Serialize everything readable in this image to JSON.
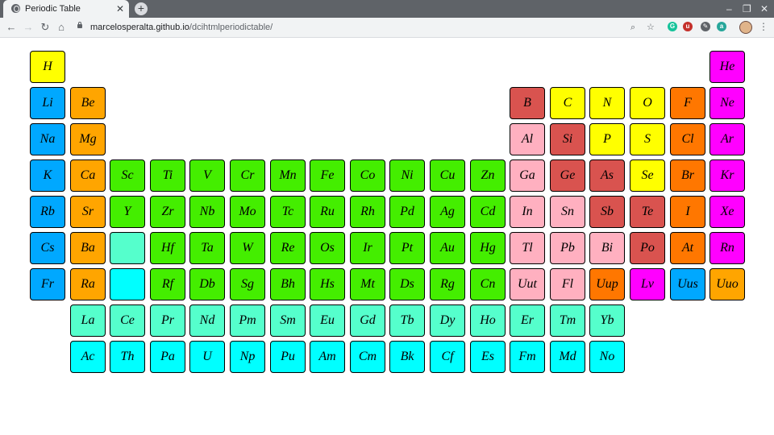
{
  "browser": {
    "tab_title": "Periodic Table",
    "tab_close": "✕",
    "new_tab": "+",
    "url_host": "marcelosperalta.github.io",
    "url_path": "/dcihtmlperiodictable/",
    "controls": {
      "minimize": "–",
      "restore": "❐",
      "close": "✕"
    },
    "nav": {
      "back": "←",
      "forward": "→",
      "reload": "↻",
      "home": "⌂"
    },
    "omni_icons": {
      "zoom": "⌕",
      "bookmark": "☆"
    },
    "extensions": [
      {
        "name": "grammarly",
        "label": "G",
        "color": "#15c39a"
      },
      {
        "name": "ublock",
        "label": "u",
        "color": "#c4302b"
      },
      {
        "name": "eyedropper",
        "label": "✎",
        "color": "#5f6368"
      },
      {
        "name": "ext-a",
        "label": "a",
        "color": "#26a69a"
      }
    ],
    "menu": "⋮"
  },
  "palette": {
    "nonmetal": "#ffff00",
    "noble": "#ff00ff",
    "alkali": "#00a8ff",
    "alkaline": "#ffa500",
    "metalloid": "#d9534f",
    "halogen": "#ff7700",
    "transition": "#44ee00",
    "post": "#ffb0c0",
    "lanth": "#55ffcc",
    "actin": "#00ffff"
  },
  "elements": [
    {
      "s": "H",
      "r": 1,
      "c": 1,
      "t": "nonmetal"
    },
    {
      "s": "He",
      "r": 1,
      "c": 18,
      "t": "noble"
    },
    {
      "s": "Li",
      "r": 2,
      "c": 1,
      "t": "alkali"
    },
    {
      "s": "Be",
      "r": 2,
      "c": 2,
      "t": "alkaline"
    },
    {
      "s": "B",
      "r": 2,
      "c": 13,
      "t": "metalloid"
    },
    {
      "s": "C",
      "r": 2,
      "c": 14,
      "t": "nonmetal"
    },
    {
      "s": "N",
      "r": 2,
      "c": 15,
      "t": "nonmetal"
    },
    {
      "s": "O",
      "r": 2,
      "c": 16,
      "t": "nonmetal"
    },
    {
      "s": "F",
      "r": 2,
      "c": 17,
      "t": "halogen"
    },
    {
      "s": "Ne",
      "r": 2,
      "c": 18,
      "t": "noble"
    },
    {
      "s": "Na",
      "r": 3,
      "c": 1,
      "t": "alkali"
    },
    {
      "s": "Mg",
      "r": 3,
      "c": 2,
      "t": "alkaline"
    },
    {
      "s": "Al",
      "r": 3,
      "c": 13,
      "t": "post"
    },
    {
      "s": "Si",
      "r": 3,
      "c": 14,
      "t": "metalloid"
    },
    {
      "s": "P",
      "r": 3,
      "c": 15,
      "t": "nonmetal"
    },
    {
      "s": "S",
      "r": 3,
      "c": 16,
      "t": "nonmetal"
    },
    {
      "s": "Cl",
      "r": 3,
      "c": 17,
      "t": "halogen"
    },
    {
      "s": "Ar",
      "r": 3,
      "c": 18,
      "t": "noble"
    },
    {
      "s": "K",
      "r": 4,
      "c": 1,
      "t": "alkali"
    },
    {
      "s": "Ca",
      "r": 4,
      "c": 2,
      "t": "alkaline"
    },
    {
      "s": "Sc",
      "r": 4,
      "c": 3,
      "t": "transition"
    },
    {
      "s": "Ti",
      "r": 4,
      "c": 4,
      "t": "transition"
    },
    {
      "s": "V",
      "r": 4,
      "c": 5,
      "t": "transition"
    },
    {
      "s": "Cr",
      "r": 4,
      "c": 6,
      "t": "transition"
    },
    {
      "s": "Mn",
      "r": 4,
      "c": 7,
      "t": "transition"
    },
    {
      "s": "Fe",
      "r": 4,
      "c": 8,
      "t": "transition"
    },
    {
      "s": "Co",
      "r": 4,
      "c": 9,
      "t": "transition"
    },
    {
      "s": "Ni",
      "r": 4,
      "c": 10,
      "t": "transition"
    },
    {
      "s": "Cu",
      "r": 4,
      "c": 11,
      "t": "transition"
    },
    {
      "s": "Zn",
      "r": 4,
      "c": 12,
      "t": "transition"
    },
    {
      "s": "Ga",
      "r": 4,
      "c": 13,
      "t": "post"
    },
    {
      "s": "Ge",
      "r": 4,
      "c": 14,
      "t": "metalloid"
    },
    {
      "s": "As",
      "r": 4,
      "c": 15,
      "t": "metalloid"
    },
    {
      "s": "Se",
      "r": 4,
      "c": 16,
      "t": "nonmetal"
    },
    {
      "s": "Br",
      "r": 4,
      "c": 17,
      "t": "halogen"
    },
    {
      "s": "Kr",
      "r": 4,
      "c": 18,
      "t": "noble"
    },
    {
      "s": "Rb",
      "r": 5,
      "c": 1,
      "t": "alkali"
    },
    {
      "s": "Sr",
      "r": 5,
      "c": 2,
      "t": "alkaline"
    },
    {
      "s": "Y",
      "r": 5,
      "c": 3,
      "t": "transition"
    },
    {
      "s": "Zr",
      "r": 5,
      "c": 4,
      "t": "transition"
    },
    {
      "s": "Nb",
      "r": 5,
      "c": 5,
      "t": "transition"
    },
    {
      "s": "Mo",
      "r": 5,
      "c": 6,
      "t": "transition"
    },
    {
      "s": "Tc",
      "r": 5,
      "c": 7,
      "t": "transition"
    },
    {
      "s": "Ru",
      "r": 5,
      "c": 8,
      "t": "transition"
    },
    {
      "s": "Rh",
      "r": 5,
      "c": 9,
      "t": "transition"
    },
    {
      "s": "Pd",
      "r": 5,
      "c": 10,
      "t": "transition"
    },
    {
      "s": "Ag",
      "r": 5,
      "c": 11,
      "t": "transition"
    },
    {
      "s": "Cd",
      "r": 5,
      "c": 12,
      "t": "transition"
    },
    {
      "s": "In",
      "r": 5,
      "c": 13,
      "t": "post"
    },
    {
      "s": "Sn",
      "r": 5,
      "c": 14,
      "t": "post"
    },
    {
      "s": "Sb",
      "r": 5,
      "c": 15,
      "t": "metalloid"
    },
    {
      "s": "Te",
      "r": 5,
      "c": 16,
      "t": "metalloid"
    },
    {
      "s": "I",
      "r": 5,
      "c": 17,
      "t": "halogen"
    },
    {
      "s": "Xe",
      "r": 5,
      "c": 18,
      "t": "noble"
    },
    {
      "s": "Cs",
      "r": 6,
      "c": 1,
      "t": "alkali"
    },
    {
      "s": "Ba",
      "r": 6,
      "c": 2,
      "t": "alkaline"
    },
    {
      "s": "",
      "r": 6,
      "c": 3,
      "t": "lanth"
    },
    {
      "s": "Hf",
      "r": 6,
      "c": 4,
      "t": "transition"
    },
    {
      "s": "Ta",
      "r": 6,
      "c": 5,
      "t": "transition"
    },
    {
      "s": "W",
      "r": 6,
      "c": 6,
      "t": "transition"
    },
    {
      "s": "Re",
      "r": 6,
      "c": 7,
      "t": "transition"
    },
    {
      "s": "Os",
      "r": 6,
      "c": 8,
      "t": "transition"
    },
    {
      "s": "Ir",
      "r": 6,
      "c": 9,
      "t": "transition"
    },
    {
      "s": "Pt",
      "r": 6,
      "c": 10,
      "t": "transition"
    },
    {
      "s": "Au",
      "r": 6,
      "c": 11,
      "t": "transition"
    },
    {
      "s": "Hg",
      "r": 6,
      "c": 12,
      "t": "transition"
    },
    {
      "s": "Tl",
      "r": 6,
      "c": 13,
      "t": "post"
    },
    {
      "s": "Pb",
      "r": 6,
      "c": 14,
      "t": "post"
    },
    {
      "s": "Bi",
      "r": 6,
      "c": 15,
      "t": "post"
    },
    {
      "s": "Po",
      "r": 6,
      "c": 16,
      "t": "metalloid"
    },
    {
      "s": "At",
      "r": 6,
      "c": 17,
      "t": "halogen"
    },
    {
      "s": "Rn",
      "r": 6,
      "c": 18,
      "t": "noble"
    },
    {
      "s": "Fr",
      "r": 7,
      "c": 1,
      "t": "alkali"
    },
    {
      "s": "Ra",
      "r": 7,
      "c": 2,
      "t": "alkaline"
    },
    {
      "s": "",
      "r": 7,
      "c": 3,
      "t": "actin"
    },
    {
      "s": "Rf",
      "r": 7,
      "c": 4,
      "t": "transition"
    },
    {
      "s": "Db",
      "r": 7,
      "c": 5,
      "t": "transition"
    },
    {
      "s": "Sg",
      "r": 7,
      "c": 6,
      "t": "transition"
    },
    {
      "s": "Bh",
      "r": 7,
      "c": 7,
      "t": "transition"
    },
    {
      "s": "Hs",
      "r": 7,
      "c": 8,
      "t": "transition"
    },
    {
      "s": "Mt",
      "r": 7,
      "c": 9,
      "t": "transition"
    },
    {
      "s": "Ds",
      "r": 7,
      "c": 10,
      "t": "transition"
    },
    {
      "s": "Rg",
      "r": 7,
      "c": 11,
      "t": "transition"
    },
    {
      "s": "Cn",
      "r": 7,
      "c": 12,
      "t": "transition"
    },
    {
      "s": "Uut",
      "r": 7,
      "c": 13,
      "t": "post"
    },
    {
      "s": "Fl",
      "r": 7,
      "c": 14,
      "t": "post"
    },
    {
      "s": "Uup",
      "r": 7,
      "c": 15,
      "t": "halogen"
    },
    {
      "s": "Lv",
      "r": 7,
      "c": 16,
      "t": "noble"
    },
    {
      "s": "Uus",
      "r": 7,
      "c": 17,
      "t": "alkali"
    },
    {
      "s": "Uuo",
      "r": 7,
      "c": 18,
      "t": "alkaline"
    },
    {
      "s": "La",
      "r": 8,
      "c": 2,
      "t": "lanth"
    },
    {
      "s": "Ce",
      "r": 8,
      "c": 3,
      "t": "lanth"
    },
    {
      "s": "Pr",
      "r": 8,
      "c": 4,
      "t": "lanth"
    },
    {
      "s": "Nd",
      "r": 8,
      "c": 5,
      "t": "lanth"
    },
    {
      "s": "Pm",
      "r": 8,
      "c": 6,
      "t": "lanth"
    },
    {
      "s": "Sm",
      "r": 8,
      "c": 7,
      "t": "lanth"
    },
    {
      "s": "Eu",
      "r": 8,
      "c": 8,
      "t": "lanth"
    },
    {
      "s": "Gd",
      "r": 8,
      "c": 9,
      "t": "lanth"
    },
    {
      "s": "Tb",
      "r": 8,
      "c": 10,
      "t": "lanth"
    },
    {
      "s": "Dy",
      "r": 8,
      "c": 11,
      "t": "lanth"
    },
    {
      "s": "Ho",
      "r": 8,
      "c": 12,
      "t": "lanth"
    },
    {
      "s": "Er",
      "r": 8,
      "c": 13,
      "t": "lanth"
    },
    {
      "s": "Tm",
      "r": 8,
      "c": 14,
      "t": "lanth"
    },
    {
      "s": "Yb",
      "r": 8,
      "c": 15,
      "t": "lanth"
    },
    {
      "s": "Ac",
      "r": 9,
      "c": 2,
      "t": "actin"
    },
    {
      "s": "Th",
      "r": 9,
      "c": 3,
      "t": "actin"
    },
    {
      "s": "Pa",
      "r": 9,
      "c": 4,
      "t": "actin"
    },
    {
      "s": "U",
      "r": 9,
      "c": 5,
      "t": "actin"
    },
    {
      "s": "Np",
      "r": 9,
      "c": 6,
      "t": "actin"
    },
    {
      "s": "Pu",
      "r": 9,
      "c": 7,
      "t": "actin"
    },
    {
      "s": "Am",
      "r": 9,
      "c": 8,
      "t": "actin"
    },
    {
      "s": "Cm",
      "r": 9,
      "c": 9,
      "t": "actin"
    },
    {
      "s": "Bk",
      "r": 9,
      "c": 10,
      "t": "actin"
    },
    {
      "s": "Cf",
      "r": 9,
      "c": 11,
      "t": "actin"
    },
    {
      "s": "Es",
      "r": 9,
      "c": 12,
      "t": "actin"
    },
    {
      "s": "Fm",
      "r": 9,
      "c": 13,
      "t": "actin"
    },
    {
      "s": "Md",
      "r": 9,
      "c": 14,
      "t": "actin"
    },
    {
      "s": "No",
      "r": 9,
      "c": 15,
      "t": "actin"
    }
  ]
}
